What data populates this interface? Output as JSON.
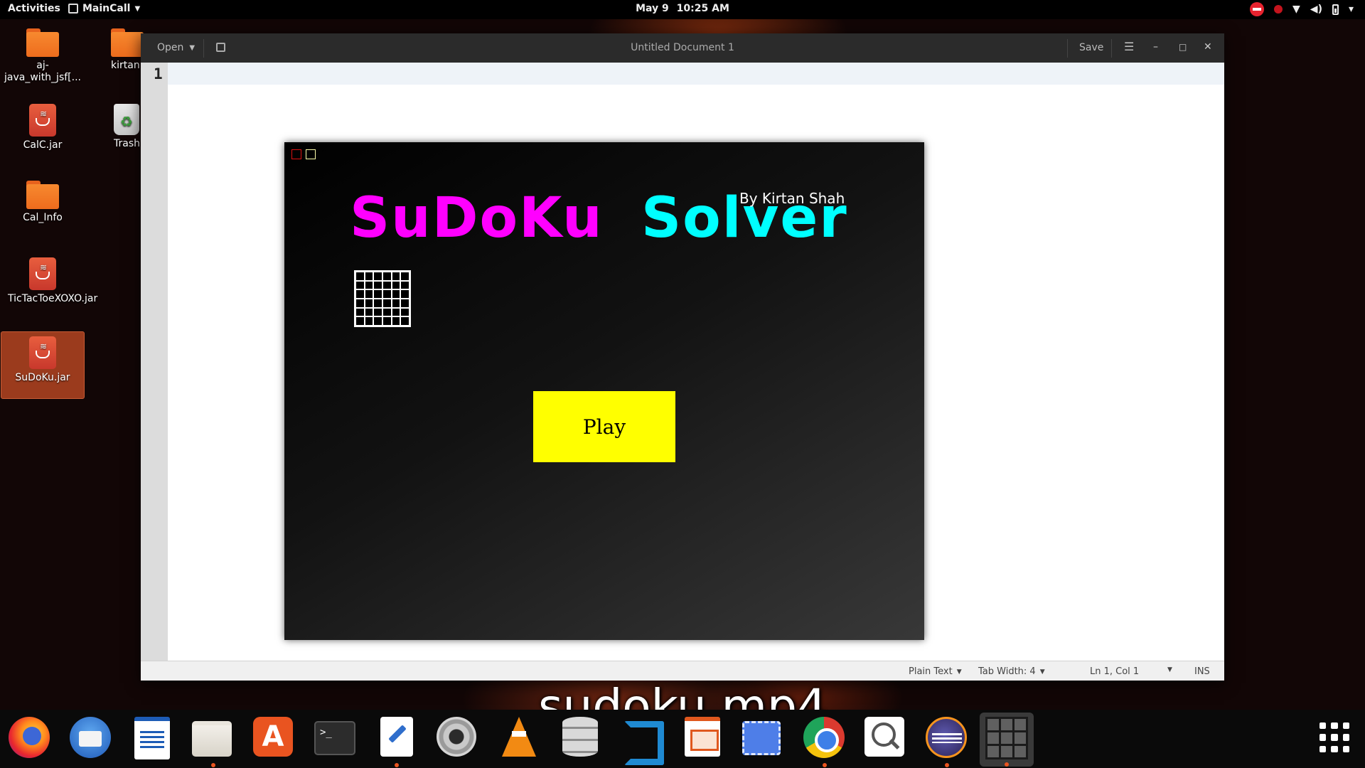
{
  "topbar": {
    "activities": "Activities",
    "app_menu": "MainCall",
    "date": "May 9",
    "time": "10:25 AM"
  },
  "desktop": {
    "icons": [
      {
        "label": "aj-java_with_jsf[...",
        "type": "folder"
      },
      {
        "label": "kirtan",
        "type": "home-folder"
      },
      {
        "label": "CalC.jar",
        "type": "jar"
      },
      {
        "label": "Trash",
        "type": "trash"
      },
      {
        "label": "Cal_Info",
        "type": "folder"
      },
      {
        "label": "TicTacToeXOXO.jar",
        "type": "jar"
      },
      {
        "label": "SuDoKu.jar",
        "type": "jar",
        "selected": true
      }
    ]
  },
  "editor": {
    "open_label": "Open",
    "title": "Untitled Document 1",
    "save_label": "Save",
    "line_number": "1",
    "status": {
      "language": "Plain Text",
      "tab_width": "Tab Width: 4",
      "position": "Ln 1, Col 1",
      "mode": "INS"
    }
  },
  "sudoku_app": {
    "title_part1": "SuDoKu",
    "title_part2": "Solver",
    "byline": "By Kirtan Shah",
    "play_label": "Play",
    "colors": {
      "title1": "#ff00ff",
      "title2": "#00ffff",
      "play_bg": "#ffff00"
    }
  },
  "dock": {
    "apps": [
      "firefox-icon",
      "thunderbird-icon",
      "libreoffice-writer-icon",
      "files-icon",
      "software-center-icon",
      "terminal-icon",
      "text-editor-icon",
      "settings-icon",
      "vlc-icon",
      "database-icon",
      "vscode-icon",
      "libreoffice-impress-icon",
      "screenshot-icon",
      "chrome-icon",
      "search-tool-icon",
      "eclipse-icon",
      "sudoku-cube-icon"
    ],
    "terminal_glyph": ">_"
  },
  "caption": "sudoku.mp4"
}
